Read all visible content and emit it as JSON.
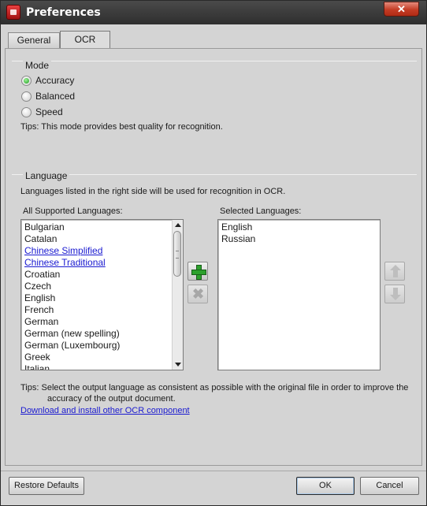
{
  "window": {
    "title": "Preferences"
  },
  "tabs": [
    {
      "label": "General"
    },
    {
      "label": "OCR"
    }
  ],
  "mode": {
    "label": "Mode",
    "options": [
      {
        "label": "Accuracy",
        "selected": true
      },
      {
        "label": "Balanced",
        "selected": false
      },
      {
        "label": "Speed",
        "selected": false
      }
    ],
    "tips": "Tips:  This mode provides best quality for recognition."
  },
  "language": {
    "label": "Language",
    "description": "Languages listed in the right side will be used for recognition in OCR.",
    "all_label": "All Supported Languages:",
    "selected_label": "Selected Languages:",
    "all_languages": [
      {
        "name": "Bulgarian",
        "link": false
      },
      {
        "name": "Catalan",
        "link": false
      },
      {
        "name": "Chinese Simplified",
        "link": true
      },
      {
        "name": "Chinese Traditional",
        "link": true
      },
      {
        "name": "Croatian",
        "link": false
      },
      {
        "name": "Czech",
        "link": false
      },
      {
        "name": "English",
        "link": false
      },
      {
        "name": "French",
        "link": false
      },
      {
        "name": "German",
        "link": false
      },
      {
        "name": "German (new spelling)",
        "link": false
      },
      {
        "name": "German (Luxembourg)",
        "link": false
      },
      {
        "name": "Greek",
        "link": false
      },
      {
        "name": "Italian",
        "link": false
      }
    ],
    "selected_languages": [
      "English",
      "Russian"
    ],
    "tips_line1": "Tips:  Select the output language as consistent as possible with the original file in order to improve the",
    "tips_line2": "accuracy of the output document.",
    "download_link": "Download and install other OCR component"
  },
  "footer": {
    "restore_label": "Restore Defaults",
    "ok_label": "OK",
    "cancel_label": "Cancel"
  },
  "icons": {
    "add": "plus-icon",
    "remove": "x-icon",
    "move_up": "arrow-up-icon",
    "move_down": "arrow-down-icon",
    "close": "close-icon"
  },
  "colors": {
    "titlebar": "#2e2e2e",
    "close_button": "#c43c25",
    "link": "#1a1ad0",
    "radio_selected": "#1a9a1a"
  }
}
